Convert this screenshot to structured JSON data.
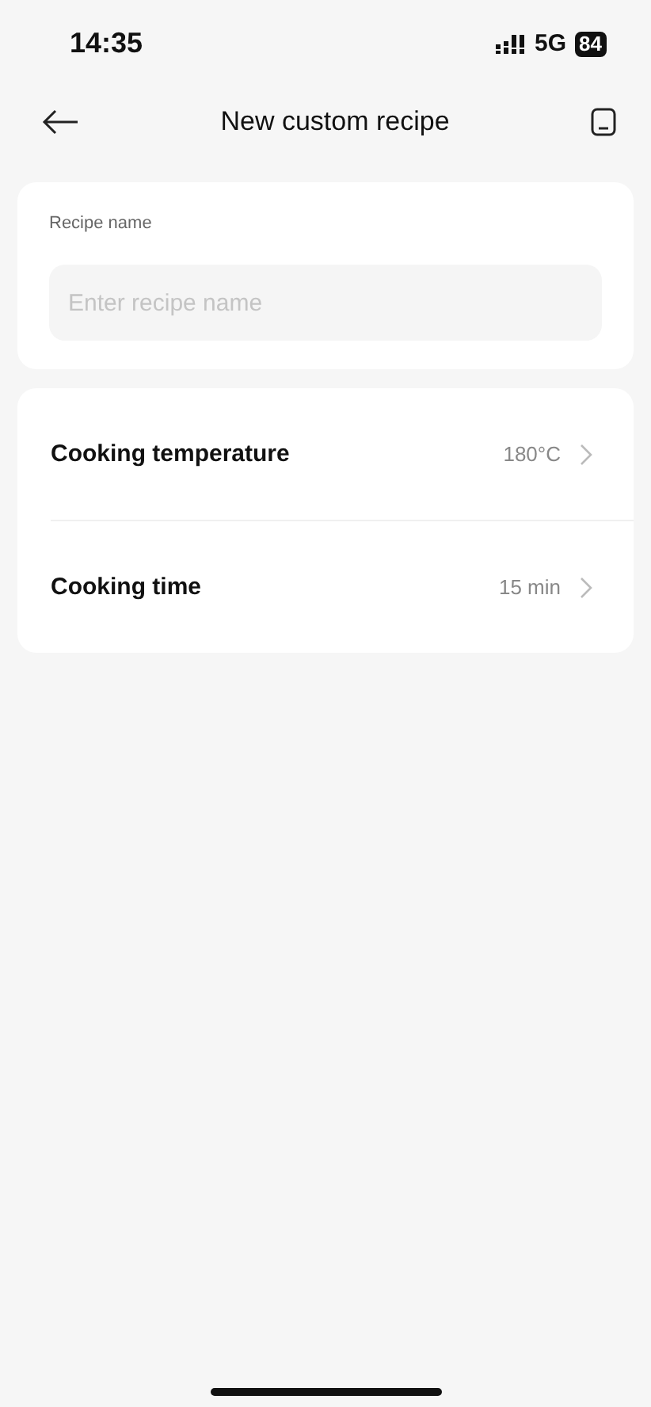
{
  "status_bar": {
    "time": "14:35",
    "network": "5G",
    "battery": "84"
  },
  "header": {
    "title": "New custom recipe"
  },
  "name_card": {
    "label": "Recipe name",
    "placeholder": "Enter recipe name"
  },
  "settings": [
    {
      "label": "Cooking temperature",
      "value": "180°C"
    },
    {
      "label": "Cooking time",
      "value": "15 min"
    }
  ]
}
